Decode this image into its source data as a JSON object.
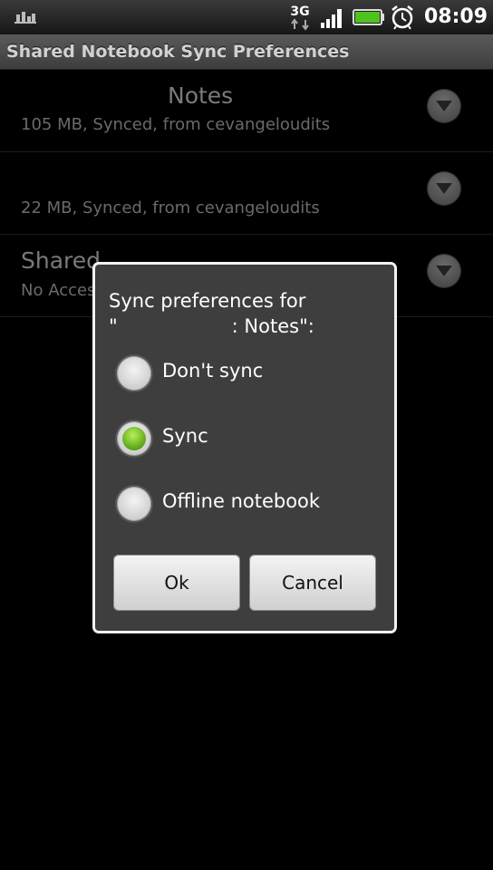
{
  "status_bar": {
    "network": "3G",
    "time": "08:09",
    "icons": [
      "notification-bars-icon",
      "3g-data-icon",
      "signal-strength-icon",
      "battery-full-icon",
      "alarm-clock-icon"
    ]
  },
  "app_bar": {
    "title": "Shared Notebook Sync Preferences"
  },
  "notebooks": [
    {
      "title": "Notes",
      "subtitle": "105 MB, Synced, from cevangeloudits"
    },
    {
      "title": "",
      "subtitle": "22 MB, Synced, from cevangeloudits"
    },
    {
      "title": "Shared",
      "subtitle": "No Access, from cevangeloudits"
    }
  ],
  "dialog": {
    "title_line1": "Sync preferences for",
    "title_line2_prefix": "\"",
    "title_line2_suffix": ": Notes\":",
    "options": [
      {
        "label": "Don't sync",
        "selected": false
      },
      {
        "label": "Sync",
        "selected": true
      },
      {
        "label": "Offline notebook",
        "selected": false
      }
    ],
    "ok_label": "Ok",
    "cancel_label": "Cancel"
  },
  "colors": {
    "accent_green": "#5aa418",
    "dialog_bg": "#3e3e3e",
    "background": "#000000"
  }
}
